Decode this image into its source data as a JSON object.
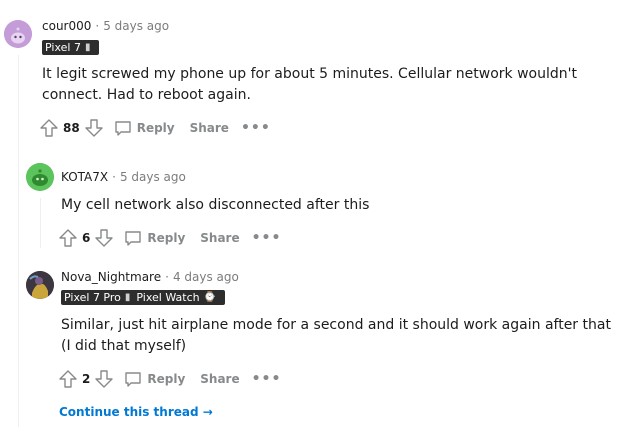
{
  "comments": [
    {
      "username": "cour000",
      "time": "5 days ago",
      "flairs": [
        "Pixel 7"
      ],
      "body_lines": [
        "It legit screwed my phone up for about 5 minutes. Cellular network wouldn't",
        "connect. Had to reboot again."
      ],
      "score": "88",
      "reply": "Reply",
      "share": "Share",
      "more": "•••"
    },
    {
      "username": "KOTA7X",
      "time": "5 days ago",
      "flairs": [],
      "body_lines": [
        "My cell network also disconnected after this"
      ],
      "score": "6",
      "reply": "Reply",
      "share": "Share",
      "more": "•••"
    },
    {
      "username": "Nova_Nightmare",
      "time": "4 days ago",
      "flairs": [
        "Pixel 7 Pro",
        "Pixel Watch"
      ],
      "body_lines": [
        "Similar, just hit airplane mode for a second and it should work again after that",
        "(I did that myself)"
      ],
      "score": "2",
      "reply": "Reply",
      "share": "Share",
      "more": "•••"
    }
  ],
  "continue_thread": "Continue this thread",
  "icons": {
    "upvote": "upvote-arrow-icon",
    "downvote": "downvote-arrow-icon",
    "reply": "speech-bubble-icon",
    "avatar1": "snoo-avatar-purple",
    "avatar2": "snoo-avatar-green",
    "avatar3": "user-avatar-photo"
  },
  "colors": {
    "link": "#0079d3",
    "muted": "#7c7c7c",
    "flair_bg": "#2d2d2d",
    "avatar1": "#c49cd8",
    "avatar2": "#5cc45c"
  }
}
